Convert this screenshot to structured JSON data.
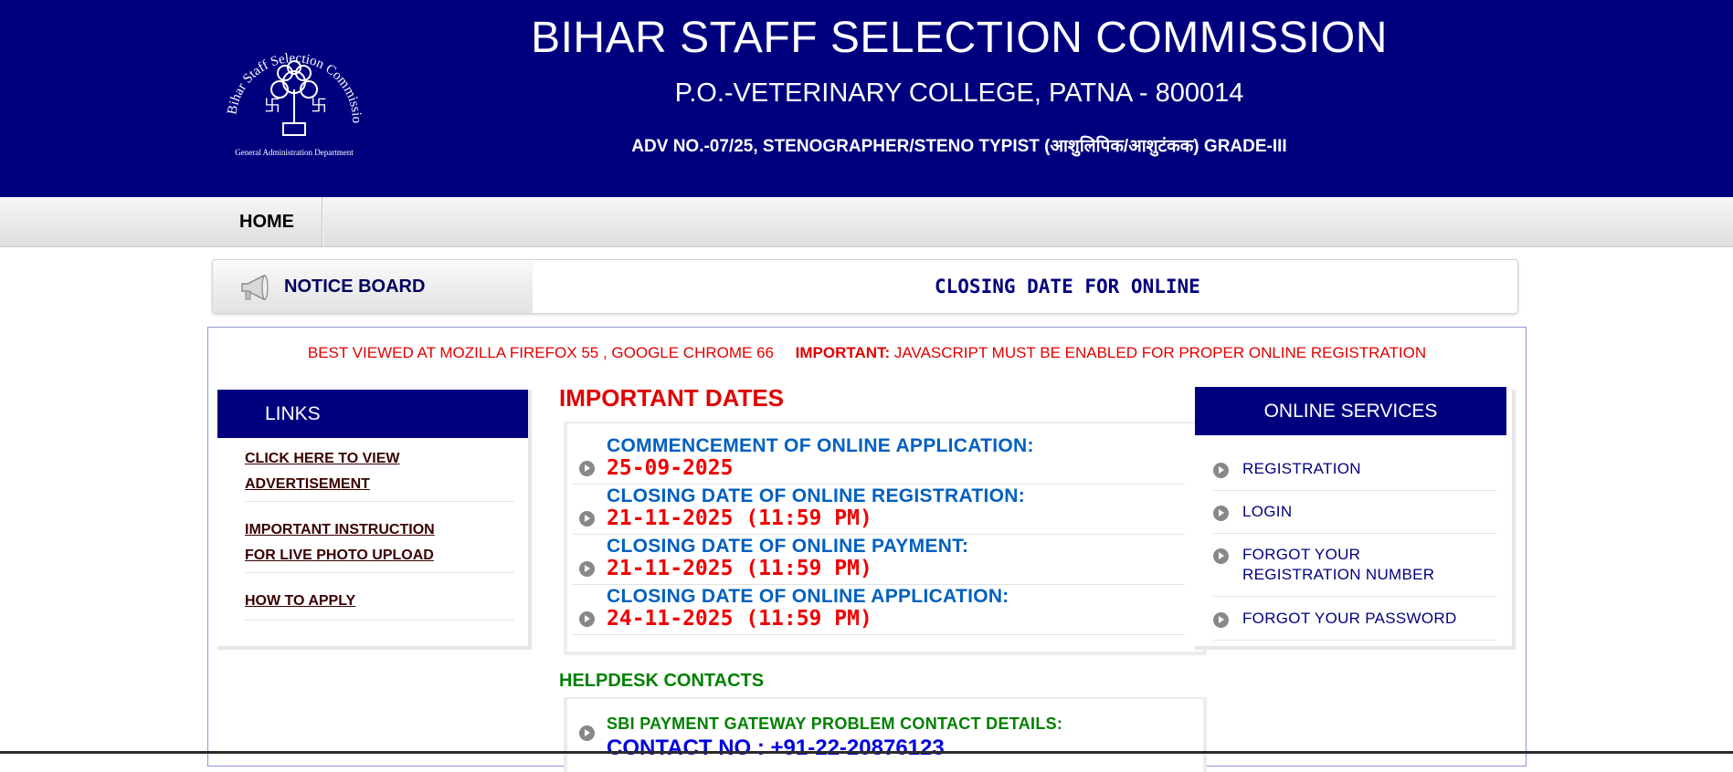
{
  "header": {
    "logo_text": "Bihar Staff Selection Commission, Patna",
    "logo_subtext": "General Administration Department",
    "title": "BIHAR STAFF SELECTION COMMISSION",
    "address": "P.O.-VETERINARY COLLEGE, PATNA - 800014",
    "advertisement": "ADV NO.-07/25, STENOGRAPHER/STENO TYPIST (आशुलिपिक/आशुटंकक) GRADE-III",
    "background_color": "#00007f"
  },
  "nav": {
    "home_label": "HOME"
  },
  "notice_board": {
    "icon": "megaphone-icon",
    "label": "NOTICE BOARD",
    "marquee_text": "CLOSING DATE FOR ONLINE"
  },
  "browser_note": {
    "text": "BEST VIEWED AT MOZILLA FIREFOX 55 , GOOGLE CHROME 66",
    "important_label": "IMPORTANT:",
    "important_text": " JAVASCRIPT MUST BE ENABLED FOR PROPER ONLINE REGISTRATION"
  },
  "links": {
    "title": "LINKS",
    "items": [
      {
        "line1": "CLICK HERE TO VIEW",
        "line2": "ADVERTISEMENT"
      },
      {
        "line1": "IMPORTANT INSTRUCTION",
        "line2": "FOR LIVE PHOTO UPLOAD"
      },
      {
        "line1": "HOW TO APPLY",
        "line2": ""
      }
    ]
  },
  "important_dates": {
    "title": "IMPORTANT DATES",
    "items": [
      {
        "label": "COMMENCEMENT OF ONLINE APPLICATION:",
        "value": "25-09-2025"
      },
      {
        "label": "CLOSING DATE OF ONLINE REGISTRATION:",
        "value": "21-11-2025 (11:59 PM)"
      },
      {
        "label": "CLOSING DATE OF ONLINE PAYMENT:",
        "value": "21-11-2025 (11:59 PM)"
      },
      {
        "label": "CLOSING DATE OF ONLINE APPLICATION:",
        "value": "24-11-2025 (11:59 PM)"
      }
    ]
  },
  "helpdesk": {
    "title": "HELPDESK CONTACTS",
    "label": "SBI PAYMENT GATEWAY PROBLEM CONTACT DETAILS:",
    "contact": "CONTACT NO : +91-22-20876123"
  },
  "online_services": {
    "title": "ONLINE SERVICES",
    "items": [
      {
        "line1": "REGISTRATION",
        "line2": ""
      },
      {
        "line1": "LOGIN",
        "line2": ""
      },
      {
        "line1": "FORGOT YOUR",
        "line2": "REGISTRATION NUMBER"
      },
      {
        "line1": "FORGOT YOUR PASSWORD",
        "line2": ""
      }
    ]
  },
  "colors": {
    "navy": "#00007f",
    "red": "#e00000",
    "date_label_blue": "#0060c0",
    "helpdesk_green": "#008000"
  }
}
